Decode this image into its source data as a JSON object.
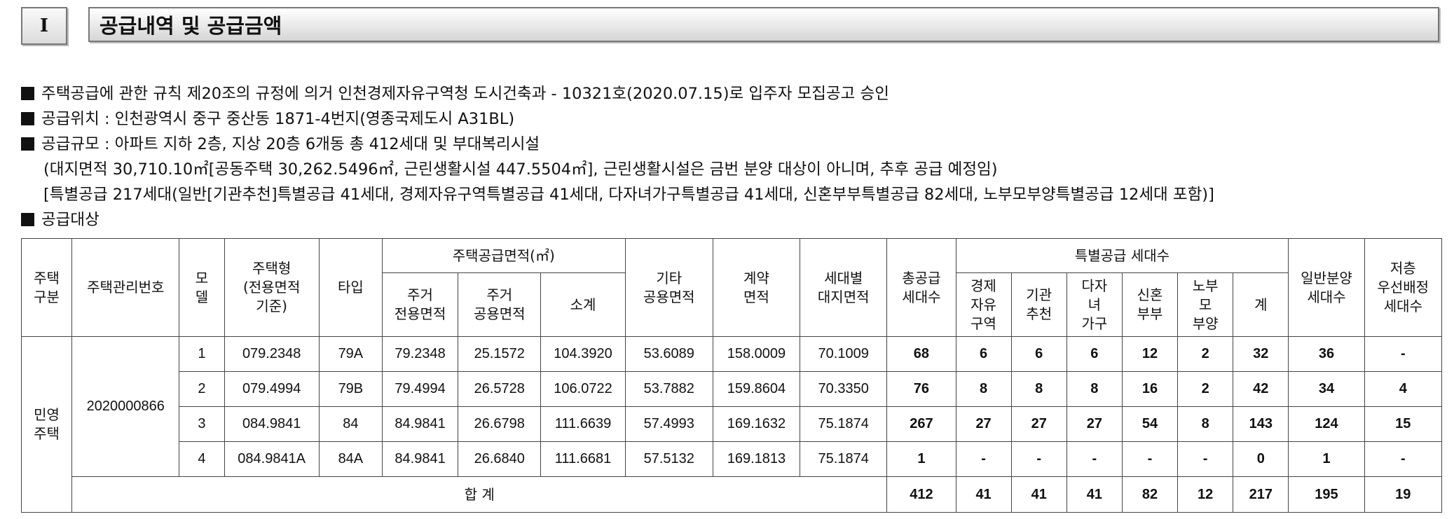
{
  "section": {
    "number": "I",
    "title": "공급내역 및 공급금액"
  },
  "bullets": [
    "주택공급에 관한 규칙 제20조의 규정에 의거 인천경제자유구역청 도시건축과 - 10321호(2020.07.15)로 입주자 모집공고 승인",
    "공급위치 : 인천광역시 중구 중산동 1871-4번지(영종국제도시 A31BL)",
    "공급규모 : 아파트 지하 2층, 지상 20층 6개동 총 412세대 및 부대복리시설",
    "(대지면적 30,710.10㎡[공동주택 30,262.5496㎡, 근린생활시설 447.5504㎡], 근린생활시설은 금번 분양 대상이 아니며, 추후 공급 예정임)",
    "[특별공급 217세대(일반[기관추천]특별공급 41세대, 경제자유구역특별공급 41세대, 다자녀가구특별공급 41세대, 신혼부부특별공급 82세대, 노부모부양특별공급 12세대 포함)]",
    "공급대상"
  ],
  "table": {
    "headers": {
      "house_type_group": "주택\n구분",
      "mgmt_no": "주택관리번호",
      "model": "모\n델",
      "house_form": "주택형\n(전용면적\n기준)",
      "type": "타입",
      "supply_area": "주택공급면적(㎡)",
      "exclusive": "주거\n전용면적",
      "common": "주거\n공용면적",
      "subtotal": "소계",
      "other_common": "기타\n공용면적",
      "contract": "계약\n면적",
      "land": "세대별\n대지면적",
      "total_units": "총공급\n세대수",
      "special": "특별공급 세대수",
      "sp_econ": "경제\n자유\n구역",
      "sp_inst": "기관\n추천",
      "sp_multi": "다자\n녀\n가구",
      "sp_newlywed": "신혼\n부부",
      "sp_elderly": "노부\n모\n부양",
      "sp_sum": "계",
      "general": "일반분양\n세대수",
      "low_floor": "저층\n우선배정\n세대수"
    },
    "group_label": "민영\n주택",
    "mgmt_number": "2020000866",
    "rows": [
      {
        "model": "1",
        "house_form": "079.2348",
        "type": "79A",
        "exclusive": "79.2348",
        "common": "25.1572",
        "subtotal": "104.3920",
        "other_common": "53.6089",
        "contract": "158.0009",
        "land": "70.1009",
        "total": "68",
        "econ": "6",
        "inst": "6",
        "multi": "6",
        "newlywed": "12",
        "elderly": "2",
        "sum": "32",
        "general": "36",
        "low_floor": "-"
      },
      {
        "model": "2",
        "house_form": "079.4994",
        "type": "79B",
        "exclusive": "79.4994",
        "common": "26.5728",
        "subtotal": "106.0722",
        "other_common": "53.7882",
        "contract": "159.8604",
        "land": "70.3350",
        "total": "76",
        "econ": "8",
        "inst": "8",
        "multi": "8",
        "newlywed": "16",
        "elderly": "2",
        "sum": "42",
        "general": "34",
        "low_floor": "4"
      },
      {
        "model": "3",
        "house_form": "084.9841",
        "type": "84",
        "exclusive": "84.9841",
        "common": "26.6798",
        "subtotal": "111.6639",
        "other_common": "57.4993",
        "contract": "169.1632",
        "land": "75.1874",
        "total": "267",
        "econ": "27",
        "inst": "27",
        "multi": "27",
        "newlywed": "54",
        "elderly": "8",
        "sum": "143",
        "general": "124",
        "low_floor": "15"
      },
      {
        "model": "4",
        "house_form": "084.9841A",
        "type": "84A",
        "exclusive": "84.9841",
        "common": "26.6840",
        "subtotal": "111.6681",
        "other_common": "57.5132",
        "contract": "169.1813",
        "land": "75.1874",
        "total": "1",
        "econ": "-",
        "inst": "-",
        "multi": "-",
        "newlywed": "-",
        "elderly": "-",
        "sum": "0",
        "general": "1",
        "low_floor": "-"
      }
    ],
    "total_row": {
      "label": "합 계",
      "total": "412",
      "econ": "41",
      "inst": "41",
      "multi": "41",
      "newlywed": "82",
      "elderly": "12",
      "sum": "217",
      "general": "195",
      "low_floor": "19"
    }
  }
}
